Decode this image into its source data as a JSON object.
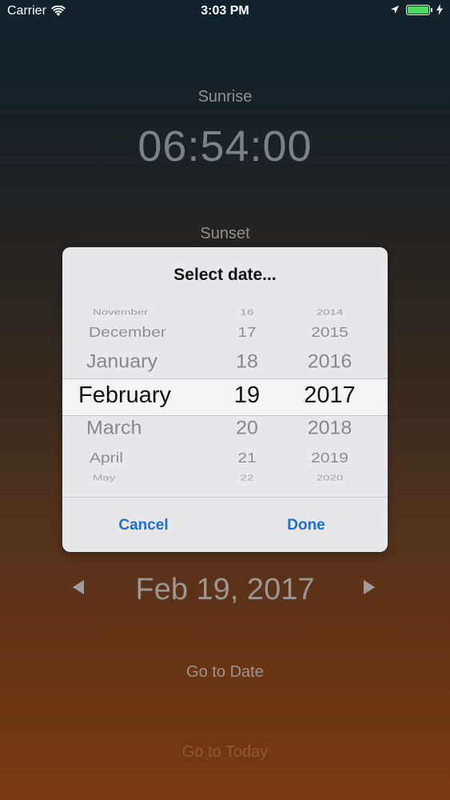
{
  "status_bar": {
    "carrier": "Carrier",
    "time": "3:03 PM",
    "battery_color": "#4cd964"
  },
  "main": {
    "sunrise_label": "Sunrise",
    "sunrise_time": "06:54:00",
    "sunset_label": "Sunset",
    "current_date": "Feb 19, 2017",
    "prev_icon": "triangle-left-icon",
    "next_icon": "triangle-right-icon",
    "go_to_date_label": "Go to Date",
    "go_to_today_label": "Go to Today"
  },
  "dialog": {
    "title": "Select date...",
    "cancel_label": "Cancel",
    "done_label": "Done",
    "accent_color": "#1e6fd9",
    "picker": {
      "months": [
        "November",
        "December",
        "January",
        "February",
        "March",
        "April",
        "May"
      ],
      "days": [
        "16",
        "17",
        "18",
        "19",
        "20",
        "21",
        "22"
      ],
      "years": [
        "2014",
        "2015",
        "2016",
        "2017",
        "2018",
        "2019",
        "2020"
      ],
      "selected": {
        "month": "February",
        "day": "19",
        "year": "2017"
      }
    }
  }
}
